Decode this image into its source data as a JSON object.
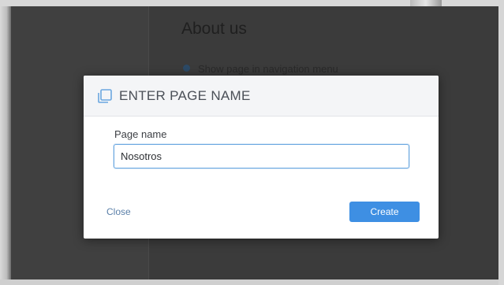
{
  "background": {
    "page_title": "About us",
    "nav_toggle_label": "Show page in navigation menu"
  },
  "dialog": {
    "icon": "copy-pages-icon",
    "title": "ENTER PAGE NAME",
    "field_label": "Page name",
    "field_value": "Nosotros",
    "close_label": "Close",
    "create_label": "Create"
  },
  "colors": {
    "accent": "#3e8fe3",
    "link": "#5a7fa8",
    "overlay": "#3a3a3a",
    "input_focus_border": "#6aa7e0"
  }
}
